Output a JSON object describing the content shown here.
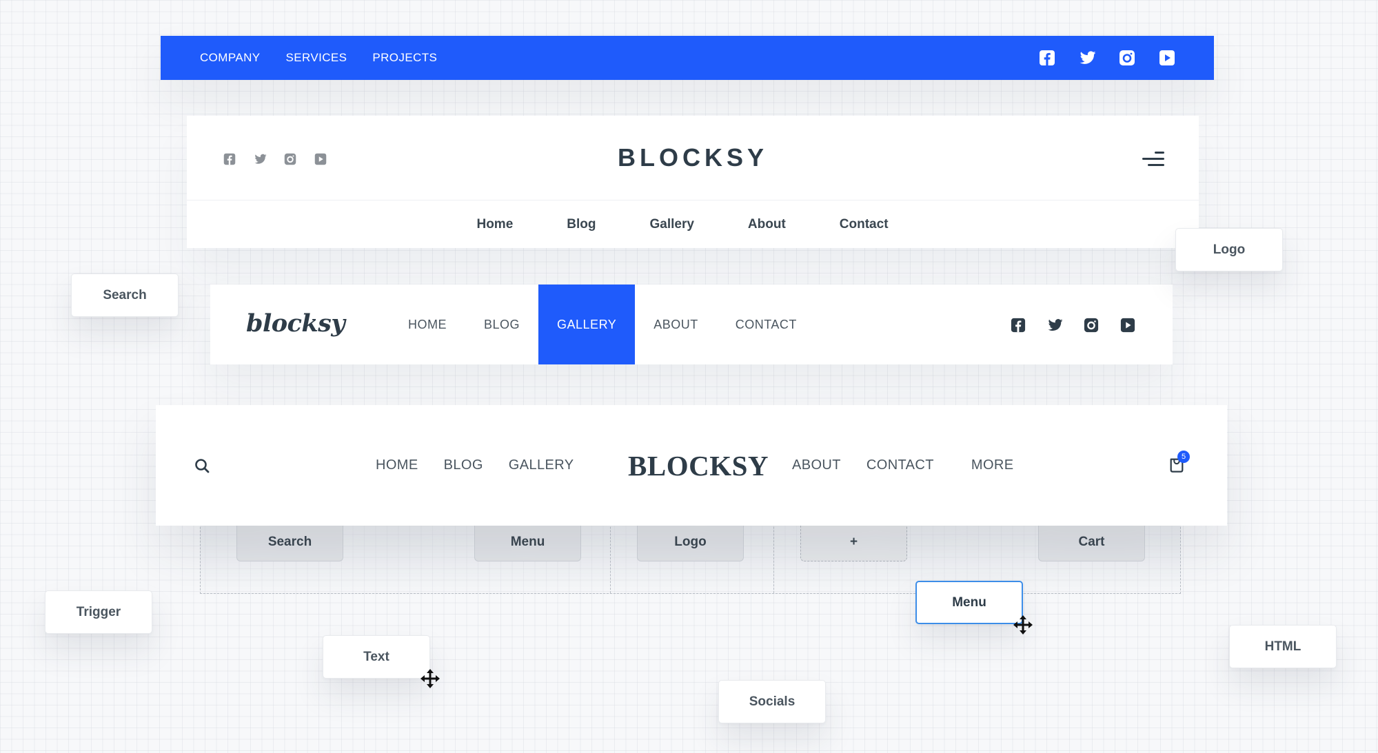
{
  "colors": {
    "accent": "#1f5bfb",
    "text_dark": "#2e3c48",
    "text_nav": "#4a555f",
    "icon_muted": "#8c9197",
    "selection": "#3c8de8"
  },
  "header_blue": {
    "nav": [
      "COMPANY",
      "SERVICES",
      "PROJECTS"
    ],
    "social_icons": [
      "facebook-icon",
      "twitter-icon",
      "instagram-icon",
      "youtube-icon"
    ]
  },
  "header_centered": {
    "logo": "BLOCKSY",
    "social_icons": [
      "facebook-icon",
      "twitter-icon",
      "instagram-icon",
      "youtube-icon"
    ],
    "menu_trigger_icon": "hamburger-menu-icon",
    "nav": [
      "Home",
      "Blog",
      "Gallery",
      "About",
      "Contact"
    ]
  },
  "header_inline": {
    "logo": "blocksy",
    "nav": [
      "HOME",
      "BLOG",
      "GALLERY",
      "ABOUT",
      "CONTACT"
    ],
    "active_item": "GALLERY",
    "social_icons": [
      "facebook-icon",
      "twitter-icon",
      "instagram-icon",
      "youtube-icon"
    ]
  },
  "header_split": {
    "search_icon": "search-icon",
    "nav_left": [
      "HOME",
      "BLOG",
      "GALLERY"
    ],
    "logo": "BLOCKSY",
    "nav_right": [
      "ABOUT",
      "CONTACT",
      "MORE"
    ],
    "cart_icon": "shopping-bag-icon",
    "cart_count": "5"
  },
  "builder": {
    "slots": [
      "Search",
      "Menu",
      "Logo",
      "+",
      "Cart"
    ],
    "floating_elements": [
      "Search",
      "Logo",
      "Trigger",
      "Text",
      "Menu",
      "HTML",
      "Socials"
    ],
    "dragging_element": "Menu"
  }
}
